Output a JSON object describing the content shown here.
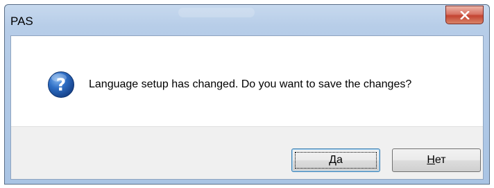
{
  "window": {
    "title": "PAS",
    "close_icon": "close-icon"
  },
  "message": {
    "icon": "question-icon",
    "text": "Language setup has changed. Do you want to save the changes?"
  },
  "buttons": {
    "yes": {
      "accel": "Д",
      "rest": "а"
    },
    "no": {
      "accel": "Н",
      "rest": "ет"
    }
  },
  "colors": {
    "title_bar": "#b7cde8",
    "close_button": "#c44331",
    "button_area": "#f0f0f0",
    "icon_blue": "#1f5fb4"
  }
}
